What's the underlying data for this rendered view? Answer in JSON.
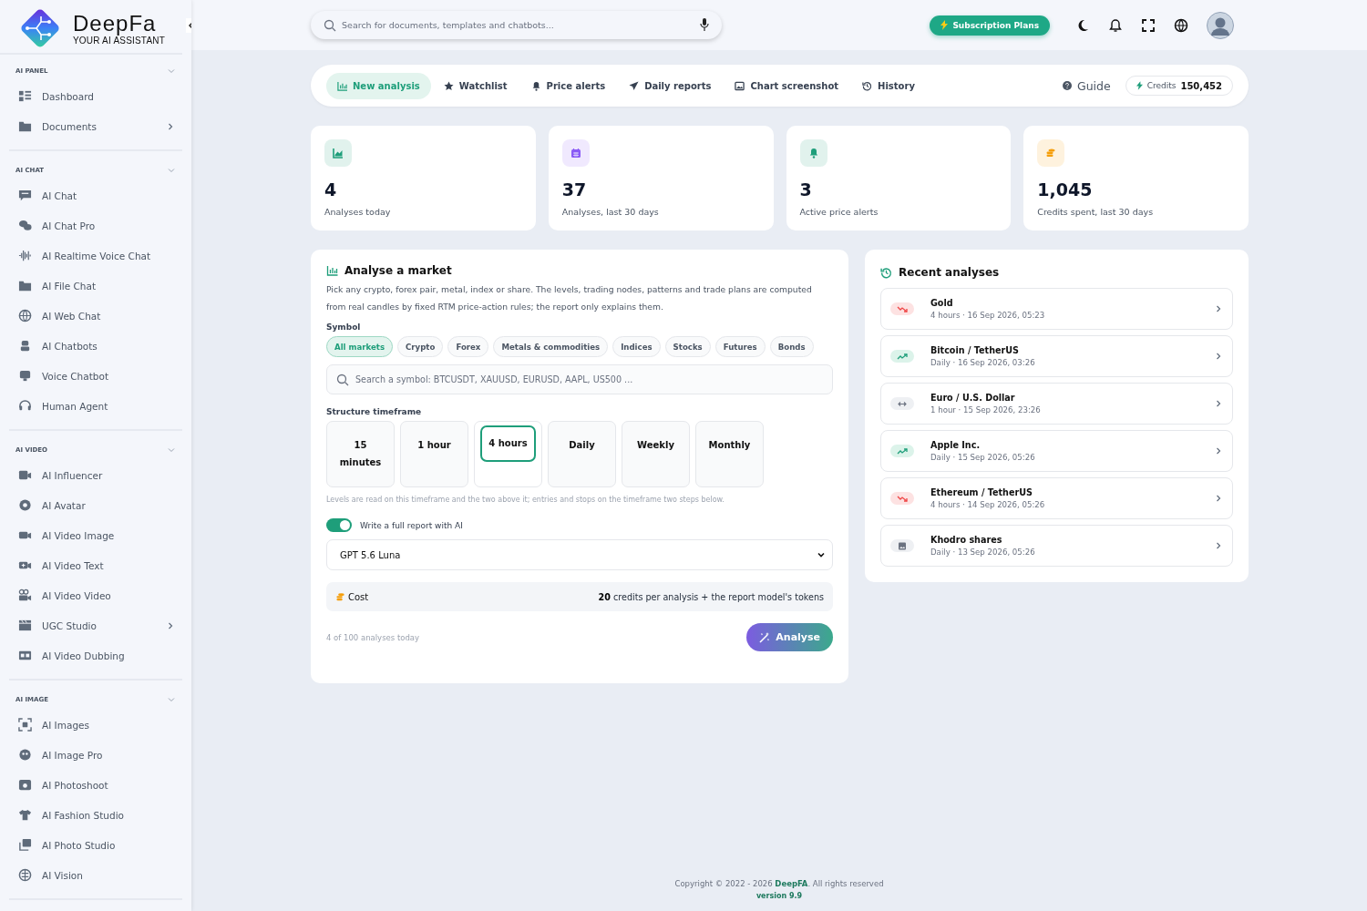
{
  "brand": {
    "name": "DeepFa",
    "tagline": "YOUR AI ASSISTANT"
  },
  "sidebar": {
    "sections": [
      {
        "title": "AI PANEL",
        "expanded": true,
        "items": [
          {
            "label": "Dashboard",
            "submenu": false
          },
          {
            "label": "Documents",
            "submenu": true
          }
        ]
      },
      {
        "title": "AI CHAT",
        "expanded": true,
        "items": [
          {
            "label": "AI Chat",
            "submenu": false
          },
          {
            "label": "AI Chat Pro",
            "submenu": false
          },
          {
            "label": "AI Realtime Voice Chat",
            "submenu": false
          },
          {
            "label": "AI File Chat",
            "submenu": false
          },
          {
            "label": "AI Web Chat",
            "submenu": false
          },
          {
            "label": "AI Chatbots",
            "submenu": false
          },
          {
            "label": "Voice Chatbot",
            "submenu": false
          },
          {
            "label": "Human Agent",
            "submenu": false
          }
        ]
      },
      {
        "title": "AI VIDEO",
        "expanded": true,
        "items": [
          {
            "label": "AI Influencer",
            "submenu": false
          },
          {
            "label": "AI Avatar",
            "submenu": false
          },
          {
            "label": "AI Video Image",
            "submenu": false
          },
          {
            "label": "AI Video Text",
            "submenu": false
          },
          {
            "label": "AI Video Video",
            "submenu": false
          },
          {
            "label": "UGC Studio",
            "submenu": true
          },
          {
            "label": "AI Video Dubbing",
            "submenu": false
          }
        ]
      },
      {
        "title": "AI IMAGE",
        "expanded": true,
        "items": [
          {
            "label": "AI Images",
            "submenu": false
          },
          {
            "label": "AI Image Pro",
            "submenu": false
          },
          {
            "label": "AI Photoshoot",
            "submenu": false
          },
          {
            "label": "AI Fashion Studio",
            "submenu": false
          },
          {
            "label": "AI Photo Studio",
            "submenu": false
          },
          {
            "label": "AI Vision",
            "submenu": false
          }
        ]
      }
    ]
  },
  "topbar": {
    "search": {
      "placeholder": "Search for documents, templates and chatbots..."
    },
    "subscription_button": "Subscription Plans"
  },
  "tabs": [
    {
      "label": "New analysis",
      "selected": true
    },
    {
      "label": "Watchlist",
      "selected": false
    },
    {
      "label": "Price alerts",
      "selected": false
    },
    {
      "label": "Daily reports",
      "selected": false
    },
    {
      "label": "Chart screenshot",
      "selected": false
    },
    {
      "label": "History",
      "selected": false
    }
  ],
  "guide": "Guide",
  "credits": {
    "label": "Credits",
    "value": "150,452"
  },
  "stats": [
    {
      "value": "4",
      "label": "Analyses today",
      "color": "#1e9e7a"
    },
    {
      "value": "37",
      "label": "Analyses, last 30 days",
      "color": "#8b5cf6"
    },
    {
      "value": "3",
      "label": "Active price alerts",
      "color": "#1e9e7a"
    },
    {
      "value": "1,045",
      "label": "Credits spent, last 30 days",
      "color": "#f59e0b"
    }
  ],
  "analyse": {
    "title": "Analyse a market",
    "description": "Pick any crypto, forex pair, metal, index or share. The levels, trading nodes, patterns and trade plans are computed from real candles by fixed RTM price-action rules; the report only explains them.",
    "symbol_label": "Symbol",
    "markets": [
      {
        "label": "All markets",
        "selected": true
      },
      {
        "label": "Crypto",
        "selected": false
      },
      {
        "label": "Forex",
        "selected": false
      },
      {
        "label": "Metals & commodities",
        "selected": false
      },
      {
        "label": "Indices",
        "selected": false
      },
      {
        "label": "Stocks",
        "selected": false
      },
      {
        "label": "Futures",
        "selected": false
      },
      {
        "label": "Bonds",
        "selected": false
      }
    ],
    "symbol_search": {
      "placeholder": "Search a symbol: BTCUSDT, XAUUSD, EURUSD, AAPL, US500 ..."
    },
    "timeframe_label": "Structure timeframe",
    "timeframes": [
      {
        "label": "15 minutes",
        "selected": false
      },
      {
        "label": "1 hour",
        "selected": false
      },
      {
        "label": "4 hours",
        "selected": true
      },
      {
        "label": "Daily",
        "selected": false
      },
      {
        "label": "Weekly",
        "selected": false
      },
      {
        "label": "Monthly",
        "selected": false
      }
    ],
    "note": "Levels are read on this timeframe and the two above it; entries and stops on the timeframe two steps below.",
    "report_toggle": {
      "label": "Write a full report with AI",
      "on": true
    },
    "model": {
      "value": "GPT 5.6 Luna"
    },
    "cost": {
      "label": "Cost",
      "text": "**20** credits per analysis + the report model's tokens"
    },
    "usage": "4 of 100 analyses today",
    "button": "Analyse"
  },
  "recent": {
    "title": "Recent analyses",
    "items": [
      {
        "title": "Gold",
        "subtitle": "4 hours · 16 Sep 2026, 05:23",
        "kind": "down"
      },
      {
        "title": "Bitcoin / TetherUS",
        "subtitle": "Daily · 16 Sep 2026, 03:26",
        "kind": "up"
      },
      {
        "title": "Euro / U.S. Dollar",
        "subtitle": "1 hour · 15 Sep 2026, 23:26",
        "kind": "flat"
      },
      {
        "title": "Apple Inc.",
        "subtitle": "Daily · 15 Sep 2026, 05:26",
        "kind": "up"
      },
      {
        "title": "Ethereum / TetherUS",
        "subtitle": "4 hours · 14 Sep 2026, 05:26",
        "kind": "down"
      },
      {
        "title": "Khodro shares",
        "subtitle": "Daily · 13 Sep 2026, 05:26",
        "kind": "image"
      }
    ]
  },
  "footer": {
    "copyright": "Copyright © 2022 - 2026 **DeepFA**. All rights reserved",
    "version": "version 9.9"
  }
}
